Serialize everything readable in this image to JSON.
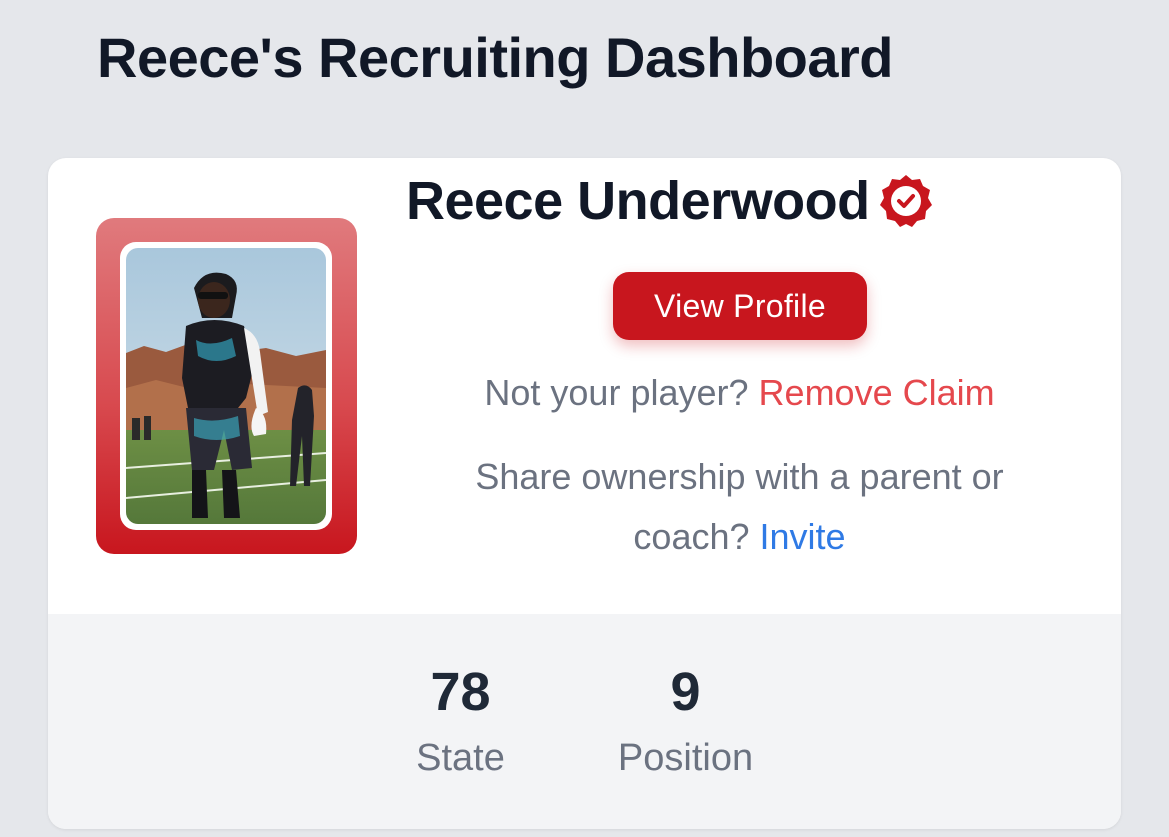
{
  "header": {
    "title": "Reece's Recruiting Dashboard"
  },
  "player": {
    "name": "Reece Underwood",
    "verified_icon": "verified-badge-icon",
    "photo_icon": "player-photo",
    "view_profile_label": "View Profile",
    "not_your_player_text": "Not your player?",
    "remove_claim_label": "Remove Claim",
    "share_text_line1": "Share ownership with a parent or",
    "share_text_line2": "coach?",
    "invite_label": "Invite"
  },
  "stats": [
    {
      "value": "78",
      "label": "State"
    },
    {
      "value": "9",
      "label": "Position"
    }
  ],
  "colors": {
    "background": "#e5e7eb",
    "accent_red": "#c8161e",
    "link_red": "#e5484d",
    "link_blue": "#2f7ae5",
    "text_dark": "#111827",
    "text_muted": "#6b7280"
  }
}
